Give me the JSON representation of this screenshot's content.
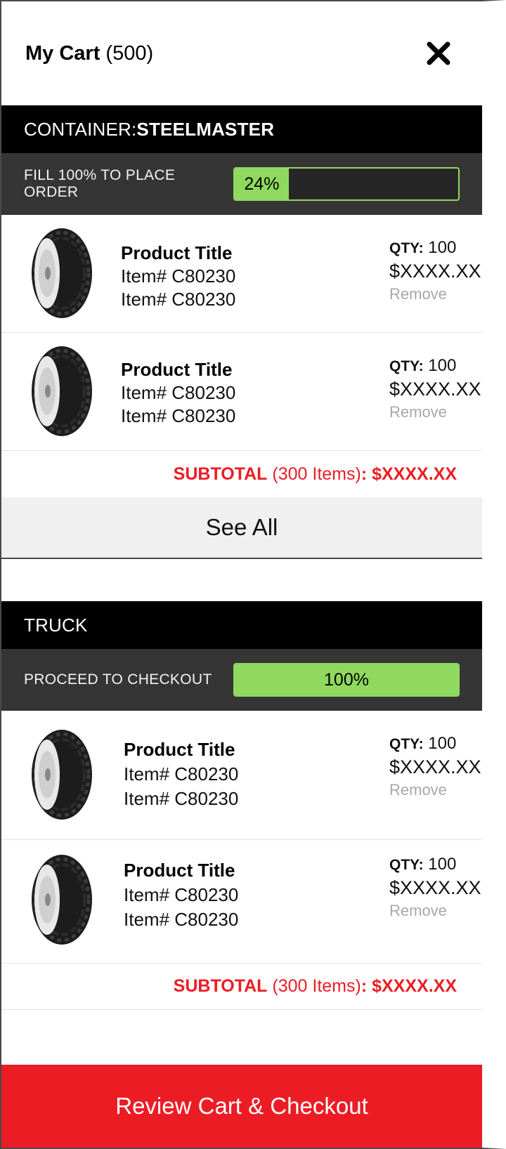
{
  "header": {
    "title": "My Cart",
    "count": "(500)",
    "close_icon": "close-icon"
  },
  "sections": [
    {
      "label": "CONTAINER: ",
      "label_strong": "STEELMASTER",
      "progress_label": "FILL 100% TO PLACE ORDER",
      "progress_value": 0.24,
      "progress_text": "24%",
      "items": [
        {
          "title": "Product Title",
          "line1": "Item# C80230",
          "line2": "Item# C80230",
          "qty_label": "QTY:",
          "qty": "100",
          "price": "$XXXX.XX",
          "remove": "Remove"
        },
        {
          "title": "Product Title",
          "line1": "Item# C80230",
          "line2": "Item# C80230",
          "qty_label": "QTY:",
          "qty": "100",
          "price": "$XXXX.XX",
          "remove": "Remove"
        }
      ],
      "subtotal": {
        "label": "SUBTOTAL",
        "items": " (300 Items)",
        "value": ": $XXXX.XX"
      },
      "see_all": "See All"
    },
    {
      "label": "TRUCK",
      "label_strong": "",
      "progress_label": "PROCEED TO CHECKOUT",
      "progress_value": 1.0,
      "progress_text": "100%",
      "items": [
        {
          "title": "Product Title",
          "line1": "Item# C80230",
          "line2": "Item# C80230",
          "qty_label": "QTY:",
          "qty": "100",
          "price": "$XXXX.XX",
          "remove": "Remove"
        },
        {
          "title": "Product Title",
          "line1": "Item# C80230",
          "line2": "Item# C80230",
          "qty_label": "QTY:",
          "qty": "100",
          "price": "$XXXX.XX",
          "remove": "Remove"
        }
      ],
      "subtotal": {
        "label": "SUBTOTAL",
        "items": " (300 Items)",
        "value": ": $XXXX.XX"
      }
    }
  ],
  "checkout": {
    "label": "Review Cart & Checkout"
  },
  "colors": {
    "accent": "#ec1c24",
    "progress": "#8fd95f",
    "bar_dark": "#353535"
  }
}
